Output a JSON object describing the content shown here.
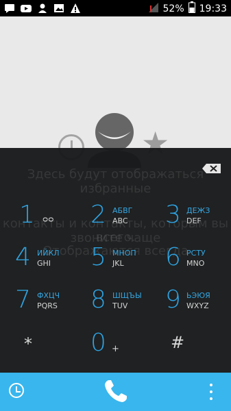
{
  "status_bar": {
    "icons": [
      "chat-icon",
      "youtube-icon",
      "person-icon",
      "image-icon",
      "warning-icon"
    ],
    "battery": "52%",
    "time": "19:33"
  },
  "favorites_hint": {
    "line1": "Здесь будут отображаться избранные",
    "line2": "контакты и контакты, которым вы звоните чаще",
    "line3": "всего.",
    "line4": "Отображаются всегда"
  },
  "dialpad": {
    "keys": [
      {
        "digit": "1",
        "letters1": "",
        "letters2": "ᴑᴑ"
      },
      {
        "digit": "2",
        "letters1": "АБВГ",
        "letters2": "ABC"
      },
      {
        "digit": "3",
        "letters1": "ДЕЖЗ",
        "letters2": "DEF"
      },
      {
        "digit": "4",
        "letters1": "ИЙКЛ",
        "letters2": "GHI"
      },
      {
        "digit": "5",
        "letters1": "МНОП",
        "letters2": "JKL"
      },
      {
        "digit": "6",
        "letters1": "РСТУ",
        "letters2": "MNO"
      },
      {
        "digit": "7",
        "letters1": "ФХЦЧ",
        "letters2": "PQRS"
      },
      {
        "digit": "8",
        "letters1": "ШЩЪЫ",
        "letters2": "TUV"
      },
      {
        "digit": "9",
        "letters1": "ЬЭЮЯ",
        "letters2": "WXYZ"
      }
    ],
    "star": "*",
    "zero": "0",
    "plus": "+",
    "hash": "#"
  },
  "colors": {
    "accent": "#2ea2e0",
    "call_bar": "#39b6ed",
    "pad_bg": "#181a1b"
  }
}
